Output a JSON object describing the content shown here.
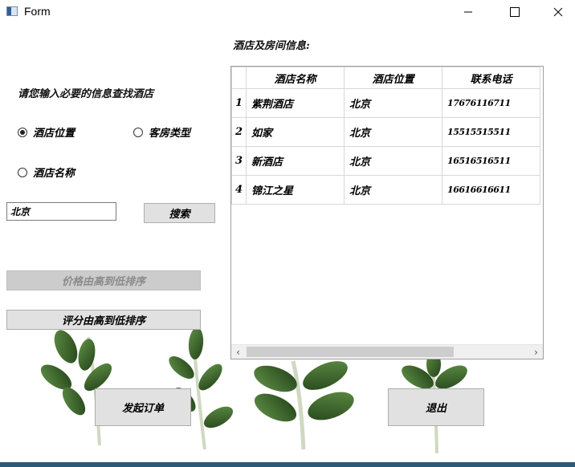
{
  "window": {
    "title": "Form",
    "controls": {
      "minimize": "minimize-icon",
      "maximize": "maximize-icon",
      "close": "close-icon"
    }
  },
  "left_panel": {
    "prompt": "请您输入必要的信息查找酒店",
    "radios": {
      "location": {
        "label": "酒店位置",
        "checked": true
      },
      "room_type": {
        "label": "客房类型",
        "checked": false
      },
      "hotel_name": {
        "label": "酒店名称",
        "checked": false
      }
    },
    "search": {
      "value": "北京"
    },
    "search_button": "搜索",
    "sort_price_button": "价格由高到低排序",
    "sort_rating_button": "评分由高到低排序"
  },
  "table_section": {
    "title": "酒店及房间信息:",
    "columns": [
      "酒店名称",
      "酒店位置",
      "联系电话"
    ],
    "rows": [
      {
        "index": "1",
        "name": "紫荆酒店",
        "location": "北京",
        "phone": "17676116711"
      },
      {
        "index": "2",
        "name": "如家",
        "location": "北京",
        "phone": "15515515511"
      },
      {
        "index": "3",
        "name": "新酒店",
        "location": "北京",
        "phone": "16516516511"
      },
      {
        "index": "4",
        "name": "锦江之星",
        "location": "北京",
        "phone": "16616616611"
      }
    ]
  },
  "actions": {
    "order_button": "发起订单",
    "exit_button": "退出"
  },
  "colors": {
    "button_bg": "#e1e1e1",
    "button_disabled_bg": "#cccccc",
    "leaf_green": "#3f6b2d",
    "taskbar": "#2b5a78"
  }
}
